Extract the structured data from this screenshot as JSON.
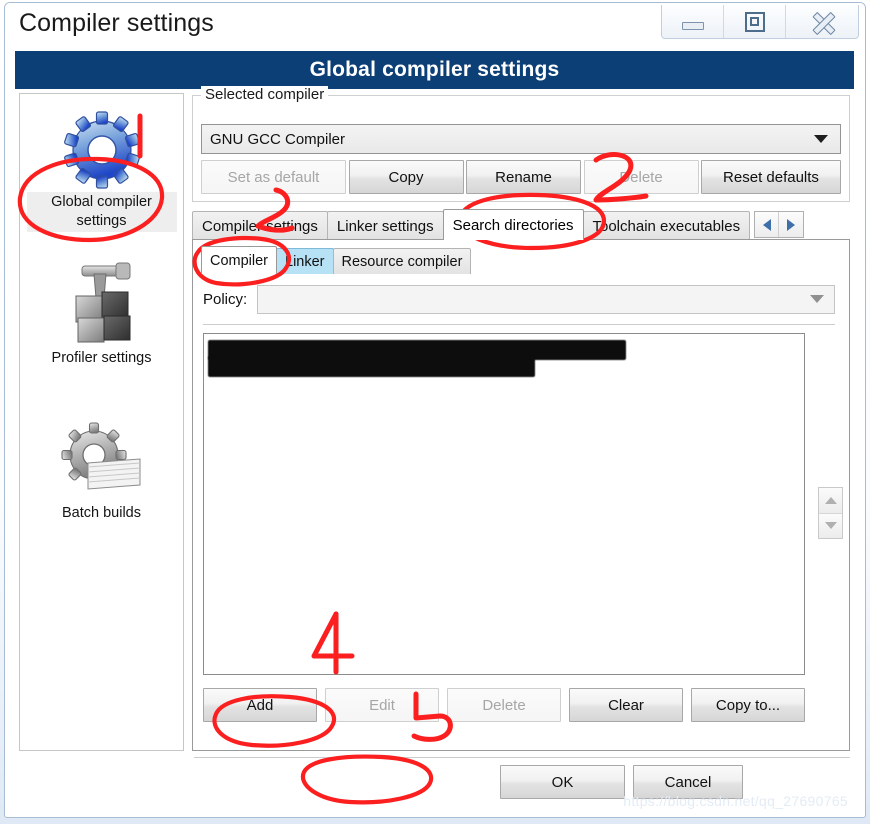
{
  "window": {
    "title": "Compiler settings",
    "caption_buttons": [
      {
        "name": "minimize-button",
        "label": "Minimize"
      },
      {
        "name": "maximize-button",
        "label": "Restore"
      },
      {
        "name": "close-button",
        "label": "Close"
      }
    ]
  },
  "banner": {
    "title": "Global compiler settings",
    "color": "#0c3f76"
  },
  "sidebar": {
    "items": [
      {
        "label": "Global compiler settings",
        "icon": "blue-gear-icon",
        "selected": true
      },
      {
        "label": "Profiler settings",
        "icon": "profiler-icon",
        "selected": false
      },
      {
        "label": "Batch builds",
        "icon": "batch-builds-icon",
        "selected": false
      }
    ]
  },
  "selected_compiler": {
    "group_title": "Selected compiler",
    "combo_value": "GNU GCC Compiler",
    "buttons": [
      {
        "label": "Set as default",
        "enabled": false
      },
      {
        "label": "Copy",
        "enabled": true
      },
      {
        "label": "Rename",
        "enabled": true
      },
      {
        "label": "Delete",
        "enabled": false
      },
      {
        "label": "Reset defaults",
        "enabled": true
      }
    ]
  },
  "tabs": {
    "items": [
      {
        "label": "Compiler settings",
        "active": false
      },
      {
        "label": "Linker settings",
        "active": false
      },
      {
        "label": "Search directories",
        "active": true
      },
      {
        "label": "Toolchain executables",
        "active": false
      }
    ],
    "scroll_left": "◀",
    "scroll_right": "▶"
  },
  "subtabs": {
    "items": [
      {
        "label": "Compiler",
        "state": "active"
      },
      {
        "label": "Linker",
        "state": "hover"
      },
      {
        "label": "Resource compiler",
        "state": "normal"
      }
    ]
  },
  "policy": {
    "label": "Policy:",
    "value": ""
  },
  "directory_list": {
    "entries": [
      {
        "text": "",
        "redacted": true
      },
      {
        "text": "",
        "redacted": true
      }
    ]
  },
  "reorder": {
    "up": "move-up",
    "down": "move-down",
    "enabled": false
  },
  "list_buttons": [
    {
      "label": "Add",
      "enabled": true
    },
    {
      "label": "Edit",
      "enabled": false
    },
    {
      "label": "Delete",
      "enabled": false
    },
    {
      "label": "Clear",
      "enabled": true
    },
    {
      "label": "Copy to...",
      "enabled": true
    }
  ],
  "footer": {
    "ok_label": "OK",
    "cancel_label": "Cancel"
  },
  "watermark": "https://blog.csdn.net/qq_27690765",
  "annotations": {
    "color": "#fb1f1f",
    "marks": [
      {
        "id": "1",
        "label": "1",
        "target": "Global compiler settings sidebar item"
      },
      {
        "id": "2",
        "label": "2",
        "target": "Delete button"
      },
      {
        "id": "3",
        "label": "3",
        "target": "Compiler settings tab / Compiler sub-tab"
      },
      {
        "id": "4",
        "label": "4",
        "target": "Directory list area"
      },
      {
        "id": "5",
        "label": "5",
        "target": "Edit button"
      }
    ]
  }
}
